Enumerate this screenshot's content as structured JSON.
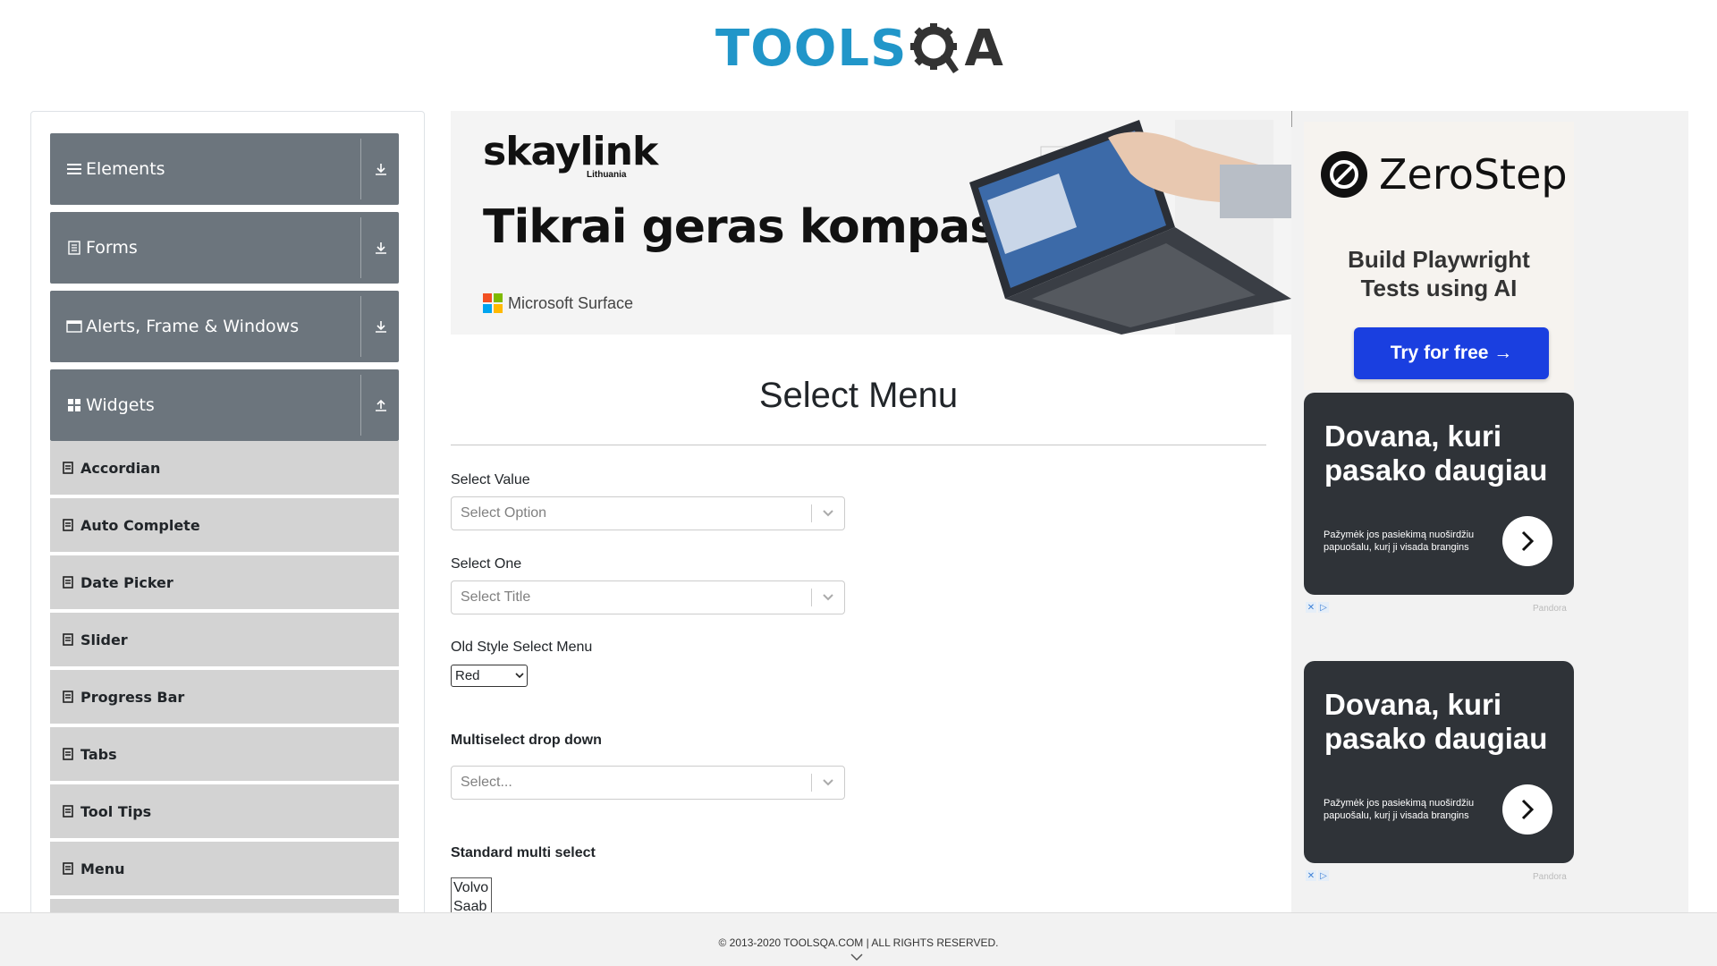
{
  "header": {
    "logo_left": "TOOLS",
    "logo_right": "A"
  },
  "sidebar": {
    "groups": [
      {
        "label": "Elements",
        "icon": "hamburger-icon",
        "arrow": "download-arrow-icon"
      },
      {
        "label": "Forms",
        "icon": "document-icon",
        "arrow": "download-arrow-icon"
      },
      {
        "label": "Alerts, Frame & Windows",
        "icon": "window-icon",
        "arrow": "download-arrow-icon"
      },
      {
        "label": "Widgets",
        "icon": "grid-icon",
        "arrow": "upload-arrow-icon"
      }
    ],
    "items": [
      {
        "label": "Accordian"
      },
      {
        "label": "Auto Complete"
      },
      {
        "label": "Date Picker"
      },
      {
        "label": "Slider"
      },
      {
        "label": "Progress Bar"
      },
      {
        "label": "Tabs"
      },
      {
        "label": "Tool Tips"
      },
      {
        "label": "Menu"
      }
    ]
  },
  "banner": {
    "brand": "skaylink",
    "brand_sub": "Lithuania",
    "headline": "Tikrai geras kompas!",
    "ms_label": "Microsoft Surface"
  },
  "main": {
    "title": "Select Menu",
    "select_value_label": "Select Value",
    "select_value_placeholder": "Select Option",
    "select_one_label": "Select One",
    "select_one_placeholder": "Select Title",
    "old_style_label": "Old Style Select Menu",
    "old_style_value": "Red",
    "multiselect_label": "Multiselect drop down",
    "multiselect_placeholder": "Select...",
    "standard_multi_label": "Standard multi select",
    "standard_multi_options": [
      "Volvo",
      "Saab"
    ]
  },
  "right_ads": {
    "zerostep_brand": "ZeroStep",
    "zerostep_line1": "Build Playwright",
    "zerostep_line2": "Tests using AI",
    "zerostep_button": "Try for free →",
    "pandora_headline": "Dovana, kuri pasako daugiau",
    "pandora_sub": "Pažymėk jos pasiekimą nuoširdžiu papuošalu, kurį ji visada brangins",
    "pandora_source": "Pandora"
  },
  "footer": {
    "text": "© 2013-2020 TOOLSQA.COM | ALL RIGHTS RESERVED."
  },
  "colors": {
    "group_bg": "#6c757d",
    "item_bg": "#d3d3d3",
    "logo_blue": "#2196c9",
    "cta_blue": "#1a3fe0",
    "ad_dark": "#2f3338"
  }
}
